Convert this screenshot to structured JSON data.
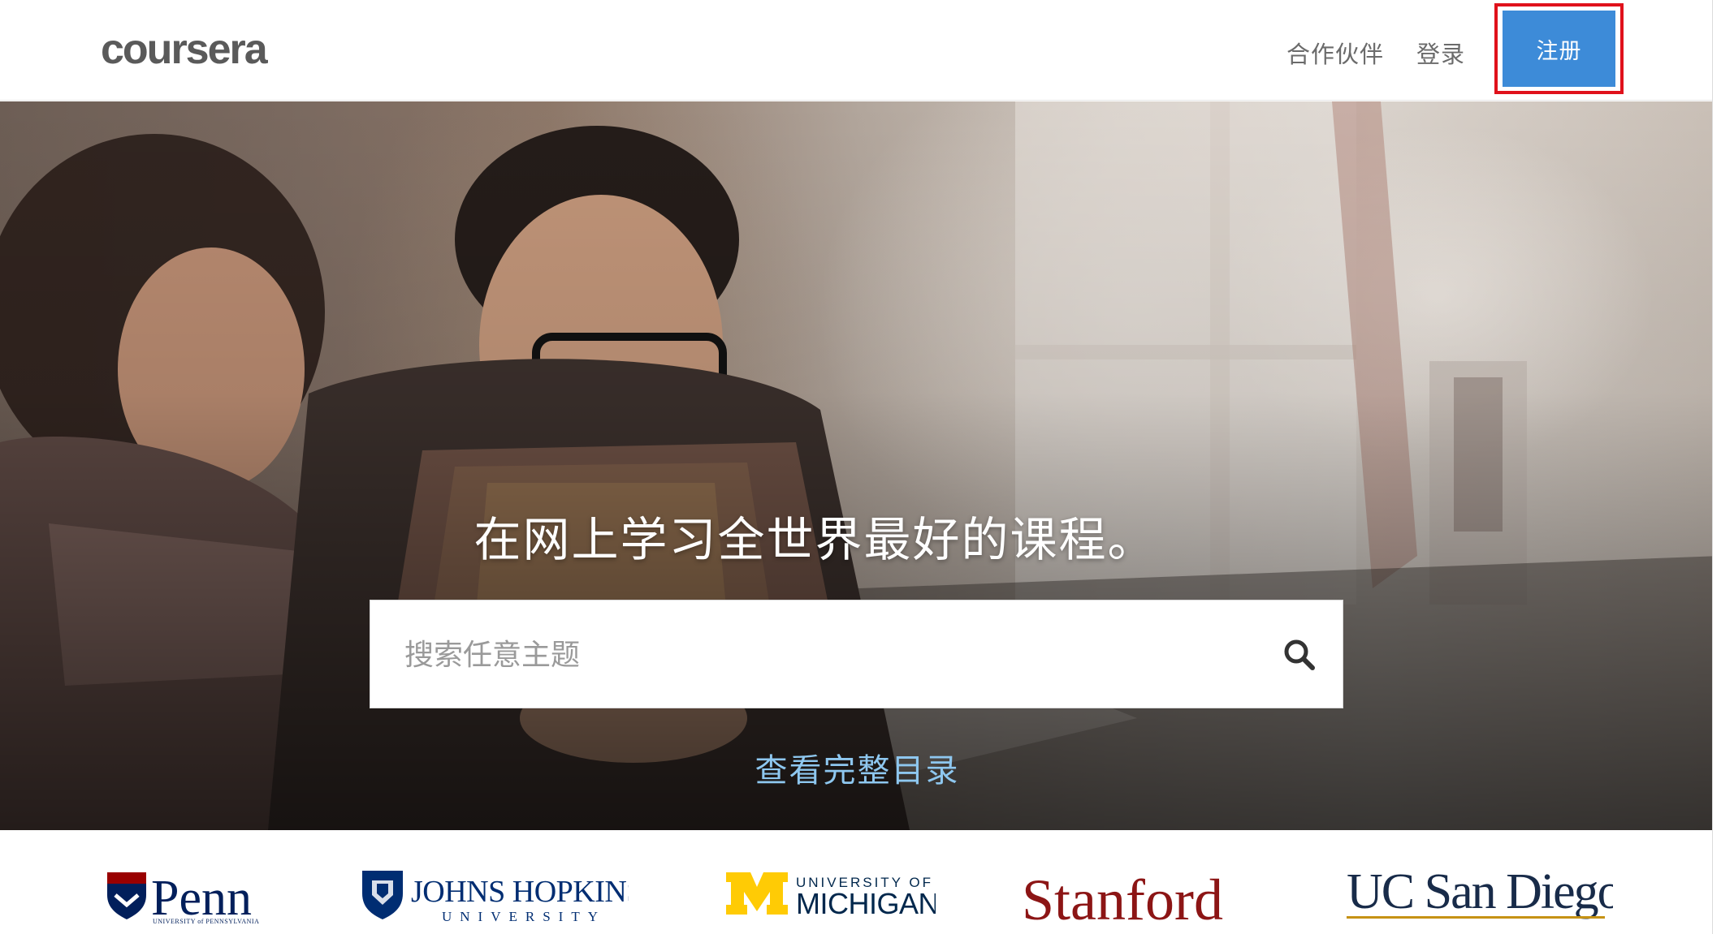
{
  "header": {
    "logo_text": "coursera",
    "nav": {
      "partners": "合作伙伴",
      "login": "登录"
    },
    "signup_label": "注册"
  },
  "hero": {
    "title": "在网上学习全世界最好的课程。",
    "search": {
      "placeholder": "搜索任意主题",
      "icon": "search-icon"
    },
    "catalog_link": "查看完整目录"
  },
  "partners": {
    "penn": {
      "name": "Penn",
      "subtitle": "UNIVERSITY of PENNSYLVANIA"
    },
    "jhu": {
      "name": "JOHNS HOPKINS",
      "subtitle": "UNIVERSITY"
    },
    "michigan": {
      "line1": "UNIVERSITY OF",
      "line2": "MICHIGAN",
      "mark": "M"
    },
    "stanford": {
      "name": "Stanford"
    },
    "ucsd": {
      "name": "UC San Diego"
    }
  },
  "colors": {
    "signup_bg": "#3d8bd8",
    "highlight_outline": "#e0111b",
    "catalog_link": "#8ec7ef",
    "stanford": "#8c1515",
    "ucsd": "#182b49",
    "michigan_maize": "#ffcb05",
    "michigan_blue": "#00274c"
  }
}
